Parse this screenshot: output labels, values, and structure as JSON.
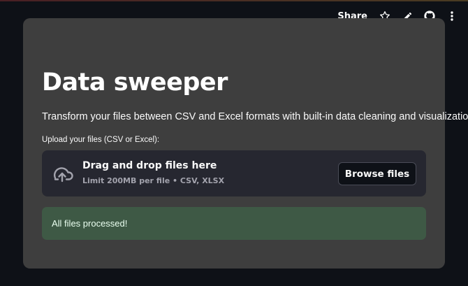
{
  "header": {
    "share_label": "Share",
    "icons": [
      "star-icon",
      "pencil-icon",
      "github-icon",
      "more-vertical-icon"
    ]
  },
  "main": {
    "title": "Data sweeper",
    "subtitle": "Transform your files between CSV and Excel formats with built-in data cleaning and visualization!",
    "uploader": {
      "label": "Upload your files (CSV or Excel):",
      "drop_text": "Drag and drop files here",
      "limit_text": "Limit 200MB per file • CSV, XLSX",
      "browse_label": "Browse files",
      "icon": "cloud-upload-icon"
    },
    "status": {
      "message": "All files processed!"
    }
  },
  "colors": {
    "background": "#0e1117",
    "card": "#3e3e3e",
    "dropzone": "#262730",
    "success_bg": "#3e5945"
  }
}
